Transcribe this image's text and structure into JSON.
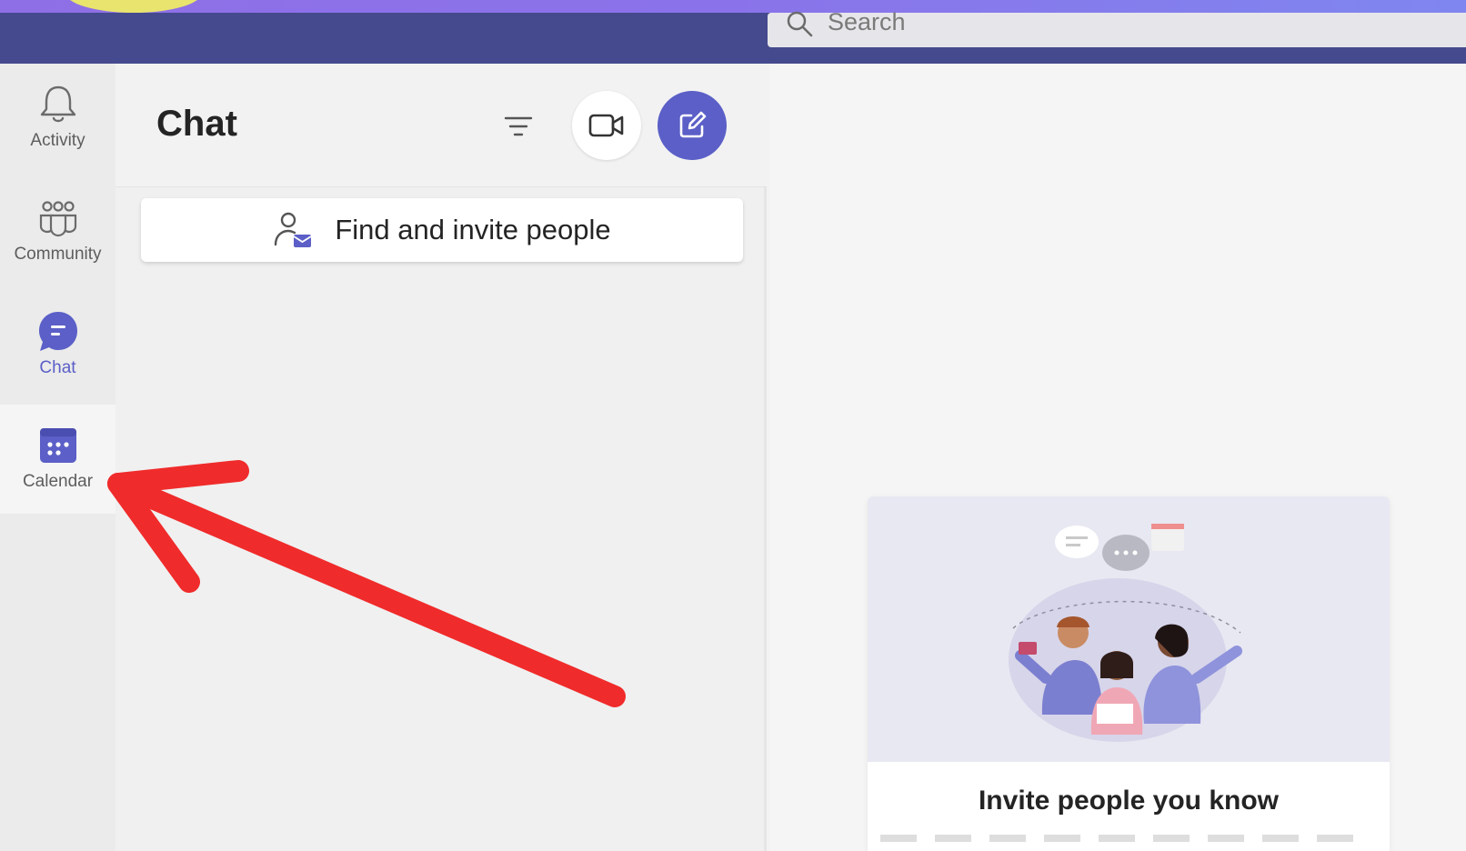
{
  "search": {
    "placeholder": "Search"
  },
  "rail": {
    "items": [
      {
        "label": "Activity",
        "icon": "bell-icon"
      },
      {
        "label": "Community",
        "icon": "community-icon"
      },
      {
        "label": "Chat",
        "icon": "chat-icon"
      },
      {
        "label": "Calendar",
        "icon": "calendar-icon"
      }
    ]
  },
  "chat_panel": {
    "title": "Chat",
    "filter_icon": "filter-icon",
    "video_icon": "video-camera-icon",
    "compose_icon": "new-chat-icon",
    "invite_label": "Find and invite people"
  },
  "main": {
    "card_title": "Invite people you know"
  },
  "colors": {
    "titlebar": "#454a8e",
    "accent": "#5b5fc7",
    "annotation_arrow": "#f02b2b"
  }
}
